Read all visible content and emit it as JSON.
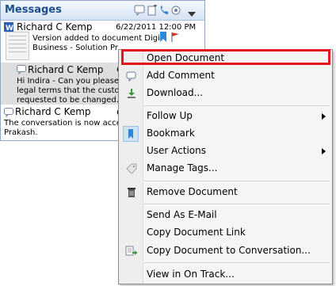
{
  "panel": {
    "title": "Messages",
    "messages": [
      {
        "author": "Richard C Kemp",
        "date": "6/22/2011 12:00 PM",
        "line1": "Version added to document Digital",
        "line2": "Business - Solution Proposal.doc"
      },
      {
        "author": "Richard C Kemp",
        "date_partial": "6",
        "line1": "Hi Indira - Can you please revi",
        "line2": "legal terms that the customer h",
        "line3": "requested to be changed."
      },
      {
        "author": "Richard C Kemp",
        "date_partial": "6",
        "line1": "The conversation is now accessible",
        "line2": "Prakash."
      }
    ]
  },
  "menu": {
    "items": [
      {
        "label": "Open Document"
      },
      {
        "label": "Add Comment"
      },
      {
        "label": "Download..."
      },
      {
        "label": "Follow Up"
      },
      {
        "label": "Bookmark"
      },
      {
        "label": "User Actions"
      },
      {
        "label": "Manage Tags..."
      },
      {
        "label": "Remove Document"
      },
      {
        "label": "Send As E-Mail"
      },
      {
        "label": "Copy Document Link"
      },
      {
        "label": "Copy Document to Conversation..."
      },
      {
        "label": "View in On Track..."
      }
    ]
  },
  "colors": {
    "highlight_border": "#e8141c",
    "panel_title": "#1f4e8c",
    "bookmark_blue": "#2f86d6"
  }
}
